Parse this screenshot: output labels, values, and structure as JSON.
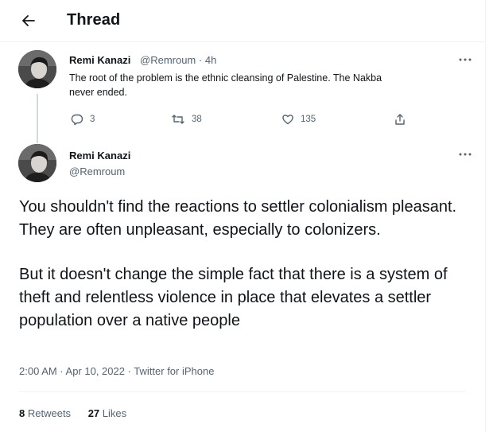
{
  "header": {
    "title": "Thread"
  },
  "parent_tweet": {
    "author_name": "Remi Kanazi",
    "author_handle": "@Remroum",
    "time": "4h",
    "text": "The root of the problem is the ethnic cleansing of Palestine. The Nakba never ended.",
    "replies": "3",
    "retweets": "38",
    "likes": "135"
  },
  "main_tweet": {
    "author_name": "Remi Kanazi",
    "author_handle": "@Remroum",
    "paragraph_1": "You shouldn't find the reactions to settler colonialism pleasant. They are often unpleasant, especially to colonizers.",
    "paragraph_2": "But it doesn't change the simple fact that there is a system of theft and relentless violence in place that elevates a settler population over a native people",
    "meta": "2:00 AM · Apr 10, 2022 · Twitter for iPhone",
    "retweets_count": "8",
    "retweets_label": "Retweets",
    "likes_count": "27",
    "likes_label": "Likes"
  },
  "icons": {
    "back": "back-arrow-icon",
    "more": "more-icon",
    "reply": "reply-icon",
    "retweet": "retweet-icon",
    "like": "heart-icon",
    "share": "share-icon"
  }
}
